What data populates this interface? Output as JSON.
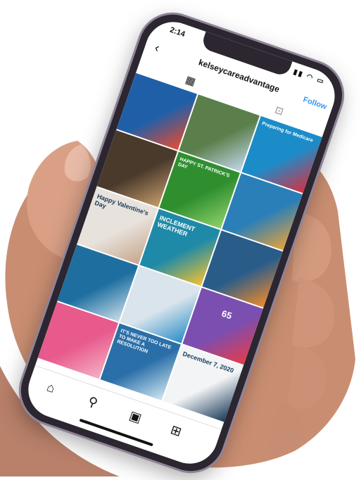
{
  "status": {
    "time": "2:14",
    "icons": "▮▮ ◠ ▭"
  },
  "profile": {
    "username": "kelseycareadvantage",
    "follow_label": "Follow"
  },
  "icons": {
    "back": "back-arrow-icon",
    "grid": "grid-icon",
    "tagged": "tagged-icon",
    "home": "home-icon",
    "search": "search-icon",
    "reels": "reels-icon",
    "shop": "shop-icon"
  },
  "posts": [
    {
      "label": "",
      "color": "#1f5fa8",
      "accent": "#e94b2f"
    },
    {
      "label": "",
      "color": "#5a7f4a",
      "accent": "#c0d7e9"
    },
    {
      "label": "Preparing for Medicare",
      "color": "#1c8cc9",
      "accent": "#d63044"
    },
    {
      "label": "",
      "color": "#4a3a2c",
      "accent": "#c49b6b"
    },
    {
      "label": "HAPPY ST. PATRICK'S DAY",
      "color": "#2f8f2f",
      "accent": "#8fd16a"
    },
    {
      "label": "",
      "color": "#2a7fb8",
      "accent": "#e8a23a"
    },
    {
      "label": "Happy Valentine's Day",
      "color": "#e8e2dc",
      "accent": "#c7a78c"
    },
    {
      "label": "INCLEMENT WEATHER",
      "color": "#1e8aa8",
      "accent": "#f2c230"
    },
    {
      "label": "",
      "color": "#2a5c8a",
      "accent": "#f08a2a"
    },
    {
      "label": "",
      "color": "#1e6fa0",
      "accent": "#c8dce8"
    },
    {
      "label": "",
      "color": "#d9e4ec",
      "accent": "#2b8ec7"
    },
    {
      "label": "65",
      "color": "#7a4fb0",
      "accent": "#e83a4a"
    },
    {
      "label": "",
      "color": "#e85a8c",
      "accent": "#f4b0c4"
    },
    {
      "label": "IT'S NEVER TOO LATE TO MAKE A RESOLUTION",
      "color": "#2b6fa8",
      "accent": "#cfe6f0"
    },
    {
      "label": "December 7, 2020",
      "color": "#f2f4f6",
      "accent": "#1a3a58"
    }
  ]
}
